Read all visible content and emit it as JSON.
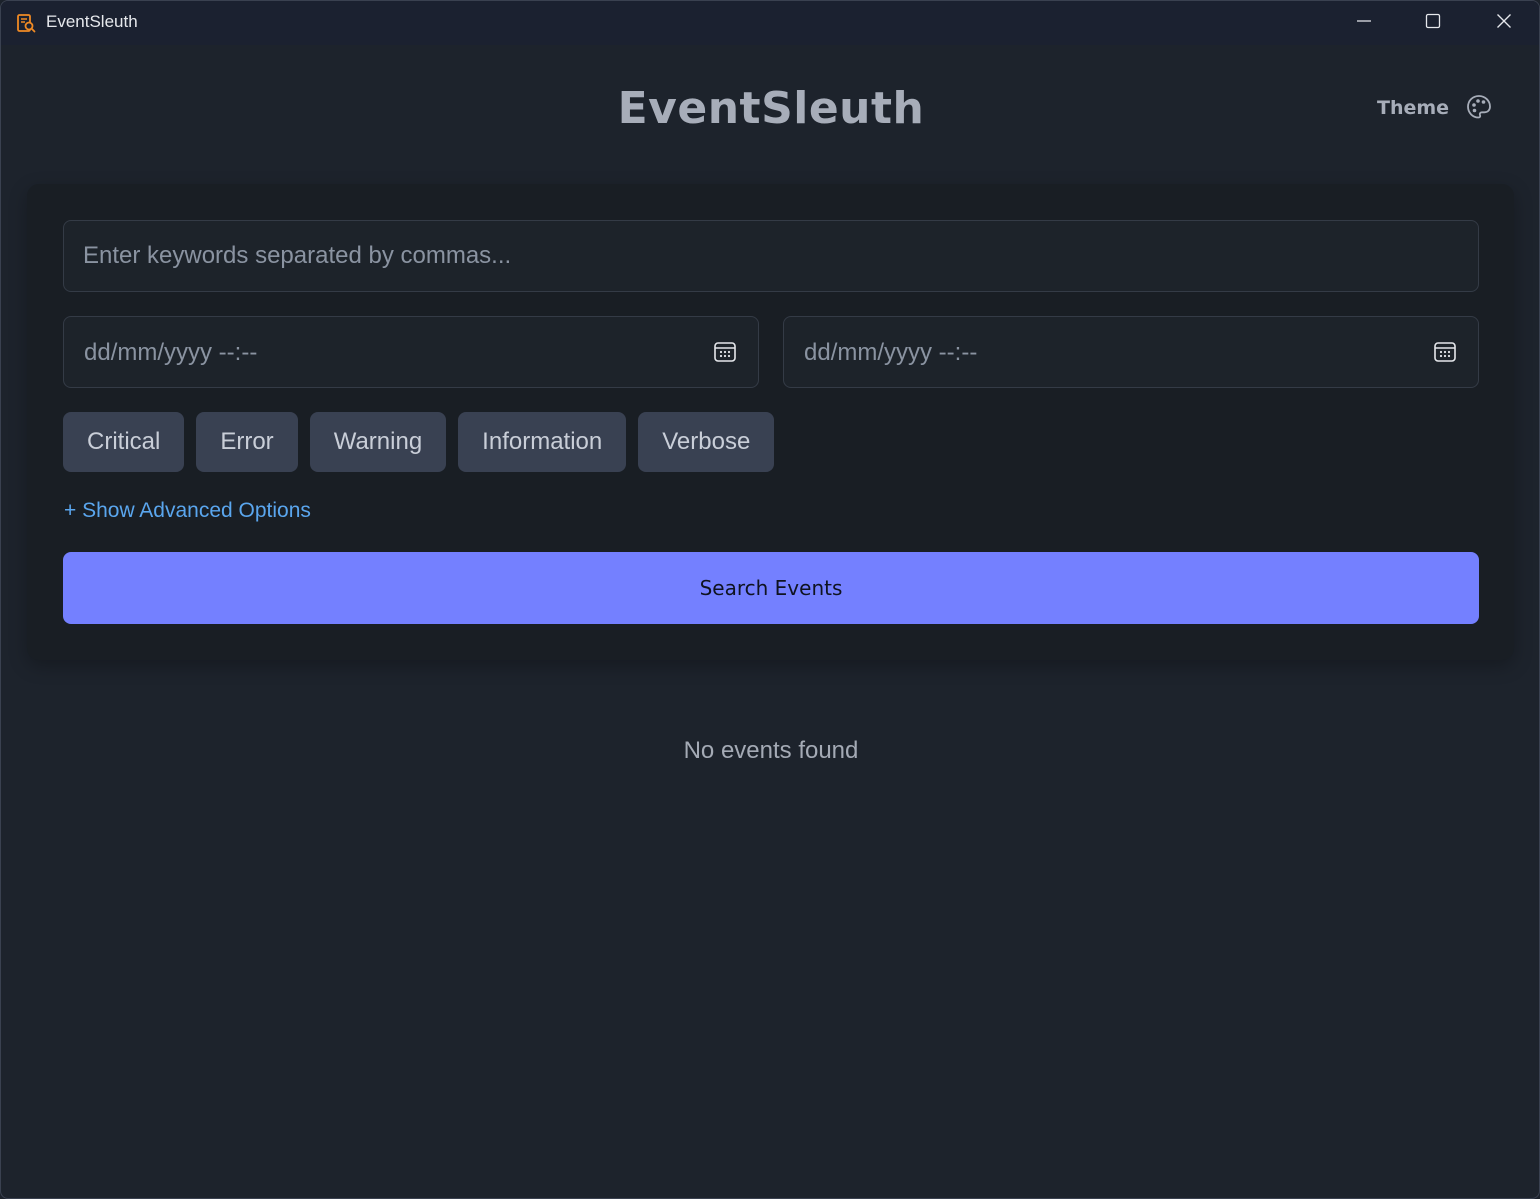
{
  "window": {
    "title": "EventSleuth",
    "icon": "search-log-icon"
  },
  "header": {
    "title": "EventSleuth",
    "theme_label": "Theme",
    "theme_icon": "palette-icon"
  },
  "search": {
    "keywords_placeholder": "Enter keywords separated by commas...",
    "date_from_placeholder": "dd/mm/yyyy --:--",
    "date_to_placeholder": "dd/mm/yyyy --:--",
    "levels": [
      "Critical",
      "Error",
      "Warning",
      "Information",
      "Verbose"
    ],
    "advanced_link": "+ Show Advanced Options",
    "submit_label": "Search Events"
  },
  "results": {
    "empty_text": "No events found"
  },
  "colors": {
    "background": "#1d232c",
    "card": "#191e24",
    "accent": "#7480ff",
    "link": "#5aa6ee",
    "chip": "#394152"
  }
}
